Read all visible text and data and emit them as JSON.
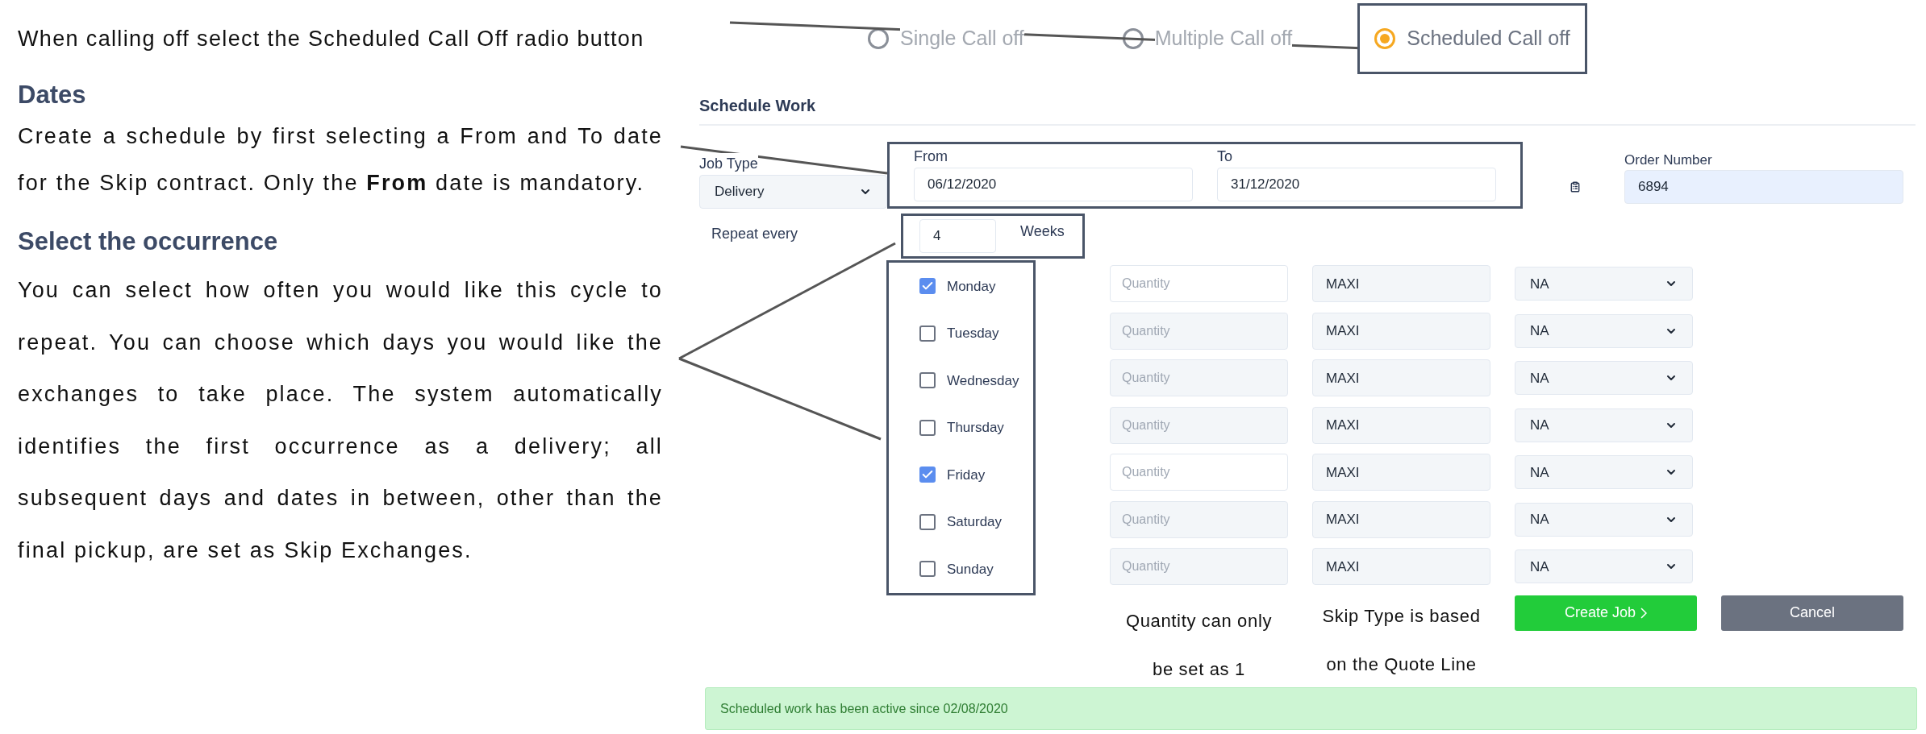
{
  "instruction": "When calling off select the Scheduled Call Off radio button",
  "call_off_options": [
    {
      "label": "Single Call off",
      "selected": false
    },
    {
      "label": "Multiple Call off",
      "selected": false
    },
    {
      "label": "Scheduled Call off",
      "selected": true
    }
  ],
  "sections": [
    {
      "heading": "Dates",
      "paragraph": "Create a schedule by first selecting a From and To date for the Skip contract. Only the **From** date is mandatory."
    },
    {
      "heading": "Select the occurrence",
      "paragraph": "You can select how often you would like this cycle to repeat. You can choose which days you would like the exchanges to take place. The system automatically identifies the first occurrence as a delivery; all subsequent days and dates in between, other than the final pickup, are set as Skip Exchanges."
    }
  ],
  "form": {
    "title": "Schedule Work",
    "job_type": {
      "label": "Job Type",
      "value": "Delivery"
    },
    "from": {
      "label": "From",
      "value": "06/12/2020"
    },
    "to": {
      "label": "To",
      "value": "31/12/2020"
    },
    "order_number": {
      "label": "Order Number",
      "value": "6894"
    },
    "repeat": {
      "label": "Repeat every",
      "value": "4",
      "unit": "Weeks"
    },
    "days": [
      {
        "day": "Monday",
        "checked": true,
        "quantity_placeholder": "Quantity",
        "skip_type": "MAXI",
        "option": "NA"
      },
      {
        "day": "Tuesday",
        "checked": false,
        "quantity_placeholder": "Quantity",
        "skip_type": "MAXI",
        "option": "NA"
      },
      {
        "day": "Wednesday",
        "checked": false,
        "quantity_placeholder": "Quantity",
        "skip_type": "MAXI",
        "option": "NA"
      },
      {
        "day": "Thursday",
        "checked": false,
        "quantity_placeholder": "Quantity",
        "skip_type": "MAXI",
        "option": "NA"
      },
      {
        "day": "Friday",
        "checked": true,
        "quantity_placeholder": "Quantity",
        "skip_type": "MAXI",
        "option": "NA"
      },
      {
        "day": "Saturday",
        "checked": false,
        "quantity_placeholder": "Quantity",
        "skip_type": "MAXI",
        "option": "NA"
      },
      {
        "day": "Sunday",
        "checked": false,
        "quantity_placeholder": "Quantity",
        "skip_type": "MAXI",
        "option": "NA"
      }
    ],
    "buttons": [
      {
        "label": "Create Job",
        "kind": "primary"
      },
      {
        "label": "Cancel",
        "kind": "secondary"
      }
    ]
  },
  "notes": [
    {
      "lines": [
        "Quantity can only",
        "be set as 1"
      ]
    },
    {
      "lines": [
        "Skip Type is based",
        "on the Quote Line"
      ]
    }
  ],
  "status_banner": "Scheduled work has been active since 02/08/2020"
}
